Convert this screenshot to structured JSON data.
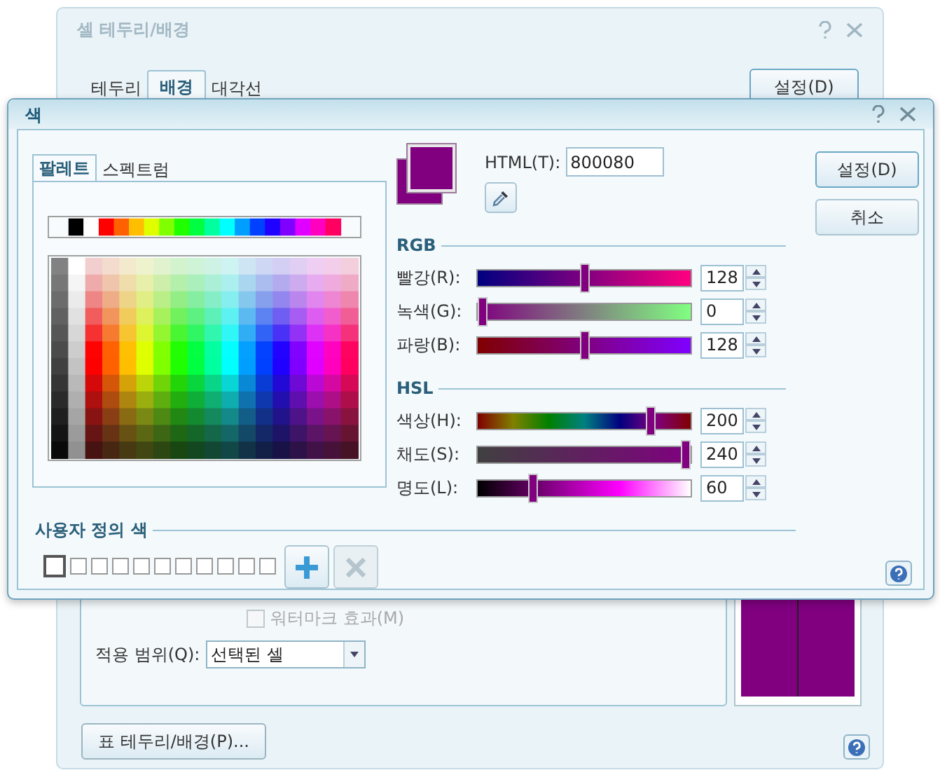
{
  "back_dialog": {
    "title": "셀 테두리/배경",
    "tabs": [
      {
        "label": "테두리",
        "selected": false
      },
      {
        "label": "배경",
        "selected": true
      },
      {
        "label": "대각선",
        "selected": false
      }
    ],
    "ok_button": "설정(D)",
    "watermark": {
      "label": "워터마크 효과(M)",
      "checked": false,
      "disabled": true
    },
    "scope": {
      "label": "적용 범위(Q):",
      "value": "선택된 셀"
    },
    "table_button": "표 테두리/배경(P)..."
  },
  "color_dialog": {
    "title": "색",
    "tabs": [
      {
        "label": "팔레트",
        "selected": true
      },
      {
        "label": "스펙트럼",
        "selected": false
      }
    ],
    "html": {
      "label": "HTML(T):",
      "value": "800080"
    },
    "rgb": {
      "title": "RGB",
      "sliders": [
        {
          "kind": "red",
          "label": "빨강(R):",
          "value": "128",
          "level": 0.5
        },
        {
          "kind": "green",
          "label": "녹색(G):",
          "value": "0",
          "level": 0
        },
        {
          "kind": "blue",
          "label": "파랑(B):",
          "value": "128",
          "level": 0.5
        }
      ]
    },
    "hsl": {
      "title": "HSL",
      "sliders": [
        {
          "kind": "hue",
          "label": "색상(H):",
          "value": "200",
          "level": 0.83
        },
        {
          "kind": "saturation",
          "label": "채도(S):",
          "value": "240",
          "level": 1
        },
        {
          "kind": "lightness",
          "label": "명도(L):",
          "value": "60",
          "level": 0.25
        }
      ]
    },
    "custom_colors": {
      "title": "사용자 정의 색",
      "swatches": [
        {
          "selected": true
        },
        {
          "selected": false
        },
        {
          "selected": false
        },
        {
          "selected": false
        },
        {
          "selected": false
        },
        {
          "selected": false
        },
        {
          "selected": false
        },
        {
          "selected": false
        },
        {
          "selected": false
        },
        {
          "selected": false
        },
        {
          "selected": false
        }
      ],
      "add_disabled": false,
      "delete_disabled": true
    },
    "buttons": [
      "설정(D)",
      "취소"
    ]
  }
}
